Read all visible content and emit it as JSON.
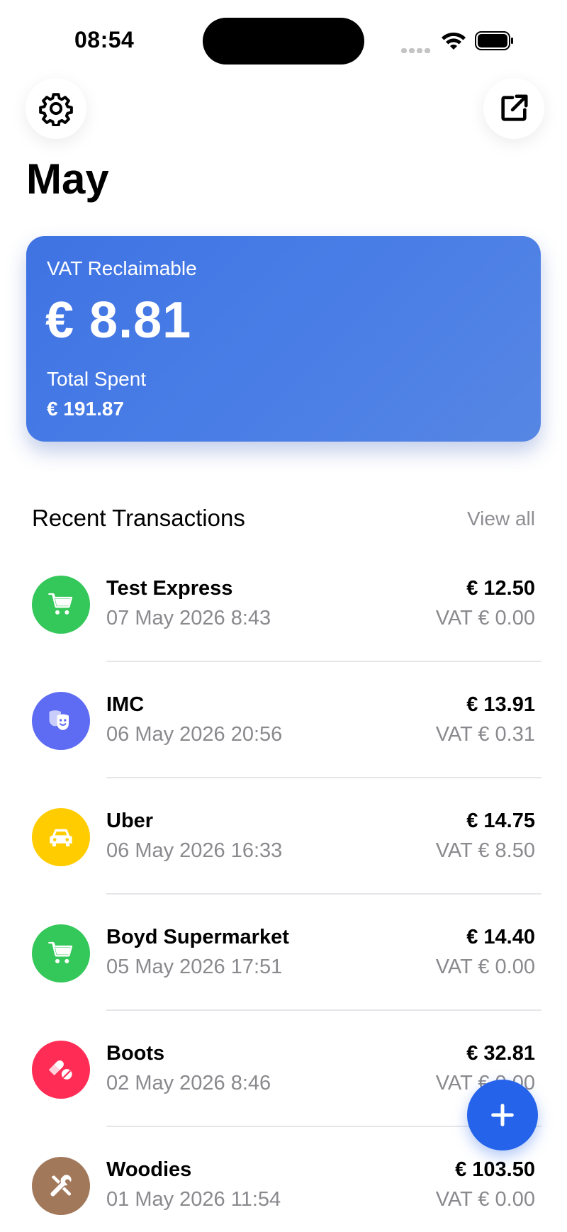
{
  "status_bar": {
    "time": "08:54"
  },
  "header": {
    "month": "May"
  },
  "summary_card": {
    "vat_label": "VAT Reclaimable",
    "vat_value": "€ 8.81",
    "total_label": "Total Spent",
    "total_value": "€ 191.87",
    "color": "#4678e5"
  },
  "recent": {
    "title": "Recent Transactions",
    "view_all": "View all",
    "items": [
      {
        "merchant": "Test Express",
        "date": "07 May 2026 8:43",
        "amount": "€ 12.50",
        "vat": "VAT € 0.00",
        "icon": "cart-icon",
        "color": "#34c759"
      },
      {
        "merchant": "IMC",
        "date": "06 May 2026 20:56",
        "amount": "€ 13.91",
        "vat": "VAT € 0.31",
        "icon": "theater-masks-icon",
        "color": "#5e6cf3"
      },
      {
        "merchant": "Uber",
        "date": "06 May 2026 16:33",
        "amount": "€ 14.75",
        "vat": "VAT € 8.50",
        "icon": "car-icon",
        "color": "#ffcc00"
      },
      {
        "merchant": "Boyd Supermarket",
        "date": "05 May 2026 17:51",
        "amount": "€ 14.40",
        "vat": "VAT € 0.00",
        "icon": "cart-icon",
        "color": "#34c759"
      },
      {
        "merchant": "Boots",
        "date": "02 May 2026 8:46",
        "amount": "€ 32.81",
        "vat": "VAT € 0.00",
        "icon": "pills-icon",
        "color": "#ff2d55"
      },
      {
        "merchant": "Woodies",
        "date": "01 May 2026 11:54",
        "amount": "€ 103.50",
        "vat": "VAT € 0.00",
        "icon": "tools-icon",
        "color": "#a2785a"
      }
    ]
  },
  "fab": {
    "icon": "plus-icon",
    "color": "#2563eb"
  }
}
